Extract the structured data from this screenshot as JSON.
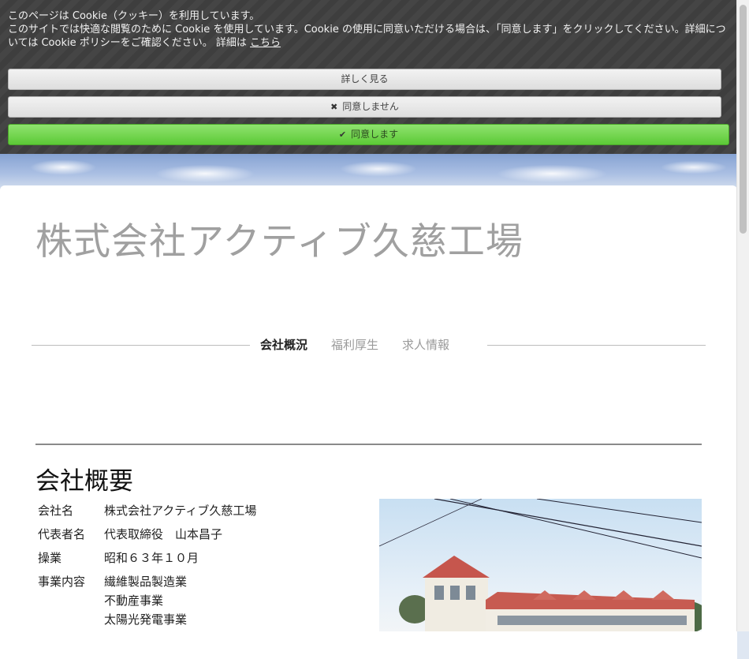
{
  "cookie_banner": {
    "line1": "このページは Cookie（クッキー）を利用しています。",
    "line2": "このサイトでは快適な閲覧のために Cookie を使用しています。Cookie の使用に同意いただける場合は、「同意します」をクリックしてください。詳細については Cookie ポリシーをご確認ください。 詳細は",
    "link_label": "こちら",
    "more_label": "詳しく見る",
    "decline_label": "同意しません",
    "accept_label": "同意します",
    "colors": {
      "accept": "#5cc936",
      "background": "#3e3e3e"
    }
  },
  "site": {
    "title": "株式会社アクティブ久慈工場"
  },
  "nav": {
    "items": [
      {
        "label": "会社概況",
        "active": true
      },
      {
        "label": "福利厚生",
        "active": false
      },
      {
        "label": "求人情報",
        "active": false
      }
    ]
  },
  "section": {
    "heading": "会社概要",
    "rows": [
      {
        "label": "会社名",
        "values": [
          "株式会社アクティブ久慈工場"
        ]
      },
      {
        "label": "代表者名",
        "values": [
          "代表取締役　山本昌子"
        ]
      },
      {
        "label": "操業",
        "values": [
          "昭和６３年１０月"
        ]
      },
      {
        "label": "事業内容",
        "values": [
          "繊維製品製造業",
          "不動産事業",
          "太陽光発電事業"
        ]
      }
    ]
  },
  "icons": {
    "decline": "close-icon",
    "accept": "check-icon"
  }
}
